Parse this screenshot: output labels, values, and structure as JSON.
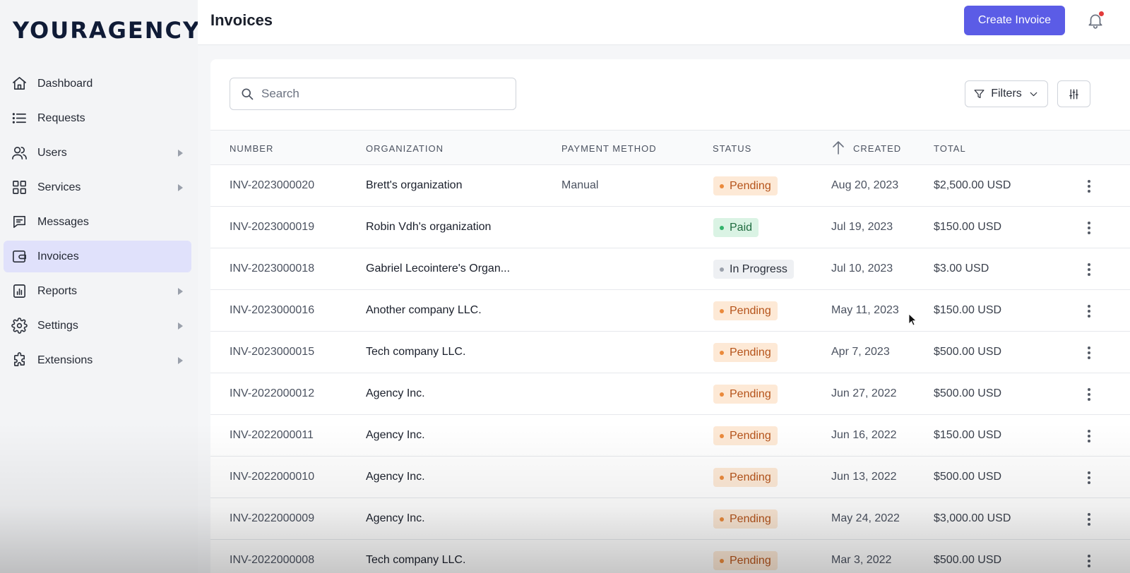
{
  "brand": {
    "logo": "YOURAGENCY"
  },
  "sidebar": {
    "items": [
      {
        "label": "Dashboard",
        "icon": "home-icon",
        "has_submenu": false,
        "active": false
      },
      {
        "label": "Requests",
        "icon": "list-icon",
        "has_submenu": false,
        "active": false
      },
      {
        "label": "Users",
        "icon": "users-icon",
        "has_submenu": true,
        "active": false
      },
      {
        "label": "Services",
        "icon": "grid-icon",
        "has_submenu": true,
        "active": false
      },
      {
        "label": "Messages",
        "icon": "message-icon",
        "has_submenu": false,
        "active": false
      },
      {
        "label": "Invoices",
        "icon": "wallet-icon",
        "has_submenu": false,
        "active": true
      },
      {
        "label": "Reports",
        "icon": "report-icon",
        "has_submenu": true,
        "active": false
      },
      {
        "label": "Settings",
        "icon": "gear-icon",
        "has_submenu": true,
        "active": false
      },
      {
        "label": "Extensions",
        "icon": "puzzle-icon",
        "has_submenu": true,
        "active": false
      }
    ]
  },
  "header": {
    "title": "Invoices",
    "create_label": "Create Invoice",
    "notification_icon": "bell-icon"
  },
  "toolbar": {
    "search_placeholder": "Search",
    "filters_label": "Filters"
  },
  "table": {
    "columns": {
      "number": "NUMBER",
      "organization": "ORGANIZATION",
      "payment_method": "PAYMENT METHOD",
      "status": "STATUS",
      "created": "CREATED",
      "total": "TOTAL"
    },
    "sort": {
      "column": "created",
      "direction": "ascending-arrow"
    },
    "rows": [
      {
        "number": "INV-2023000020",
        "organization": "Brett's organization",
        "payment_method": "Manual",
        "status": "Pending",
        "created": "Aug 20, 2023",
        "total": "$2,500.00 USD"
      },
      {
        "number": "INV-2023000019",
        "organization": "Robin Vdh's organization",
        "payment_method": "",
        "status": "Paid",
        "created": "Jul 19, 2023",
        "total": "$150.00 USD"
      },
      {
        "number": "INV-2023000018",
        "organization": "Gabriel Lecointere's Organ...",
        "payment_method": "",
        "status": "In Progress",
        "created": "Jul 10, 2023",
        "total": "$3.00 USD"
      },
      {
        "number": "INV-2023000016",
        "organization": "Another company LLC.",
        "payment_method": "",
        "status": "Pending",
        "created": "May 11, 2023",
        "total": "$150.00 USD"
      },
      {
        "number": "INV-2023000015",
        "organization": "Tech company LLC.",
        "payment_method": "",
        "status": "Pending",
        "created": "Apr 7, 2023",
        "total": "$500.00 USD"
      },
      {
        "number": "INV-2022000012",
        "organization": "Agency Inc.",
        "payment_method": "",
        "status": "Pending",
        "created": "Jun 27, 2022",
        "total": "$500.00 USD"
      },
      {
        "number": "INV-2022000011",
        "organization": "Agency Inc.",
        "payment_method": "",
        "status": "Pending",
        "created": "Jun 16, 2022",
        "total": "$150.00 USD"
      },
      {
        "number": "INV-2022000010",
        "organization": "Agency Inc.",
        "payment_method": "",
        "status": "Pending",
        "created": "Jun 13, 2022",
        "total": "$500.00 USD"
      },
      {
        "number": "INV-2022000009",
        "organization": "Agency Inc.",
        "payment_method": "",
        "status": "Pending",
        "created": "May 24, 2022",
        "total": "$3,000.00 USD"
      },
      {
        "number": "INV-2022000008",
        "organization": "Tech company LLC.",
        "payment_method": "",
        "status": "Pending",
        "created": "Mar 3, 2022",
        "total": "$500.00 USD"
      }
    ]
  },
  "colors": {
    "accent": "#5b5ce6",
    "active_nav": "#e0e1fb",
    "pending_bg": "#fde9d6",
    "paid_bg": "#daf3e4",
    "progress_bg": "#eef0f3"
  }
}
